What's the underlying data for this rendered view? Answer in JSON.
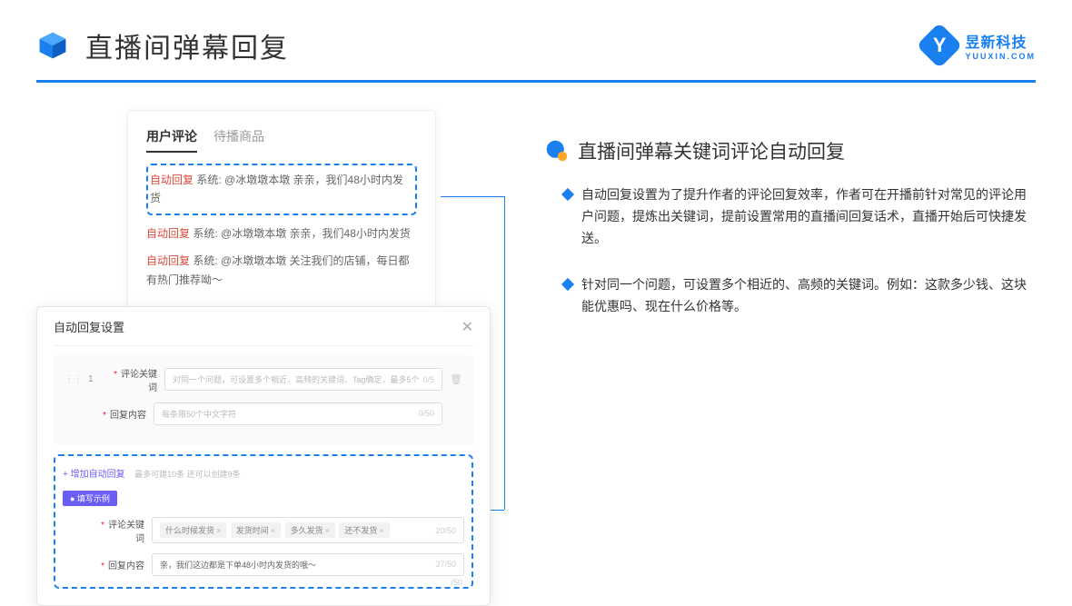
{
  "header": {
    "title": "直播间弹幕回复"
  },
  "brand": {
    "name": "昱新科技",
    "domain": "YUUXIN.COM"
  },
  "comments": {
    "tabs": {
      "a": "用户评论",
      "b": "待播商品"
    },
    "row1_tag": "自动回复",
    "row1_text": "系统: @冰墩墩本墩 亲亲，我们48小时内发货",
    "row2_tag": "自动回复",
    "row2_text": "系统: @冰墩墩本墩 亲亲，我们48小时内发货",
    "row3_tag": "自动回复",
    "row3_text": "系统: @冰墩墩本墩 关注我们的店铺，每日都有热门推荐呦～"
  },
  "settings": {
    "title": "自动回复设置",
    "num": "1",
    "label_kw": "评论关键词",
    "placeholder_kw": "对同一个问题，可设置多个相近、高频的关键词，Tag确定，最多5个",
    "counter_kw": "0/5",
    "label_content": "回复内容",
    "placeholder_content": "每条限50个中文字符",
    "counter_content": "0/50",
    "add_link": "+ 增加自动回复",
    "add_hint": "最多可建10条 还可以创建9条",
    "example_badge": "● 填写示例",
    "ex_label_kw": "评论关键词",
    "ex_tag1": "什么时候发货",
    "ex_tag2": "发货时间",
    "ex_tag3": "多久发货",
    "ex_tag4": "还不发货",
    "ex_counter_kw": "20/50",
    "ex_label_content": "回复内容",
    "ex_content_text": "亲，我们这边都是下单48小时内发货的哦～",
    "ex_counter_content": "37/50",
    "ext_counter": "/50"
  },
  "right": {
    "subtitle": "直播间弹幕关键词评论自动回复",
    "b1": "自动回复设置为了提升作者的评论回复效率，作者可在开播前针对常见的评论用户问题，提炼出关键词，提前设置常用的直播间回复话术，直播开始后可快捷发送。",
    "b2": "针对同一个问题，可设置多个相近的、高频的关键词。例如：这款多少钱、这块能优惠吗、现在什么价格等。"
  }
}
